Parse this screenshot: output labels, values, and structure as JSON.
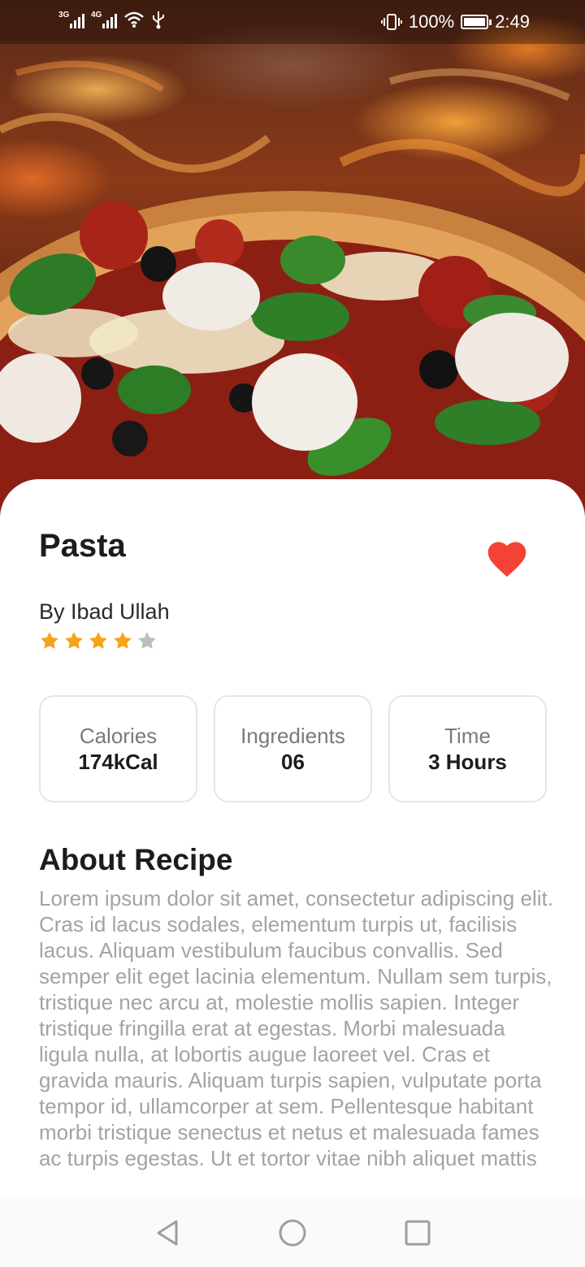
{
  "status_bar": {
    "network_1": "3G",
    "network_2": "4G",
    "battery": "100%",
    "time": "2:49"
  },
  "hero": {
    "image": "pizza-on-fire-photo"
  },
  "recipe": {
    "title": "Pasta",
    "author": "By Ibad Ullah",
    "rating": 4,
    "rating_max": 5,
    "favorite": true
  },
  "stats": [
    {
      "label": "Calories",
      "value": "174kCal"
    },
    {
      "label": "Ingredients",
      "value": "06"
    },
    {
      "label": "Time",
      "value": "3 Hours"
    }
  ],
  "about": {
    "title": "About Recipe",
    "text": "Lorem ipsum dolor sit amet, consectetur adipiscing elit. Cras id lacus sodales, elementum turpis ut, facilisis lacus. Aliquam vestibulum faucibus convallis. Sed semper elit eget lacinia elementum. Nullam sem turpis, tristique nec arcu at, molestie mollis sapien. Integer tristique fringilla erat at egestas. Morbi malesuada ligula nulla, at lobortis augue laoreet vel. Cras et gravida mauris. Aliquam turpis sapien, vulputate porta tempor id, ullamcorper at sem. Pellentesque habitant morbi tristique senectus et netus et malesuada fames ac turpis egestas. Ut et tortor vitae nibh aliquet mattis"
  },
  "colors": {
    "accent_heart": "#F44336",
    "star_filled": "#F7A21B",
    "star_empty": "#BDBDBD",
    "text_primary": "#1C1C1C",
    "text_muted": "#A3A3A3"
  },
  "nav": {
    "back_icon": "triangle-back-icon",
    "home_icon": "circle-home-icon",
    "recents_icon": "square-recents-icon"
  }
}
